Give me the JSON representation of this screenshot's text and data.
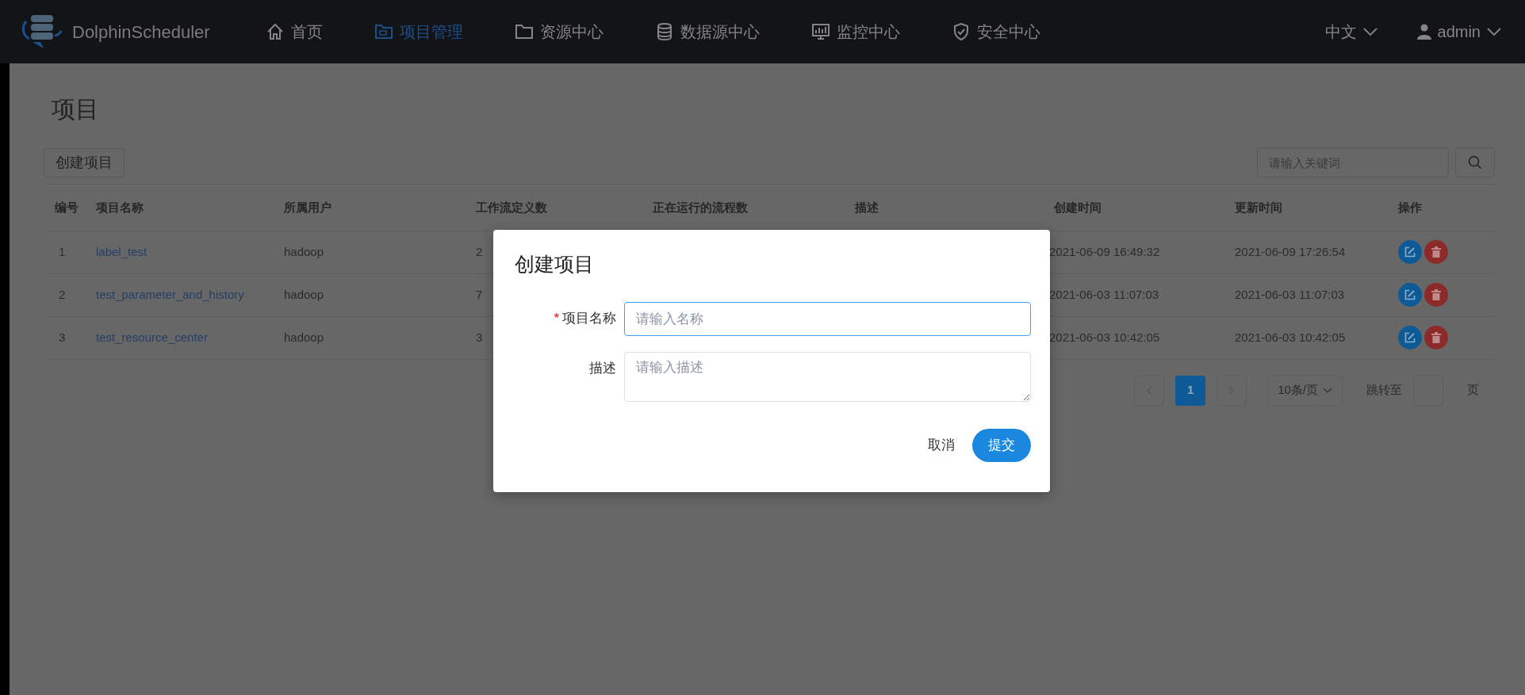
{
  "app": {
    "name": "DolphinScheduler"
  },
  "nav": [
    {
      "label": "首页",
      "kind": "home",
      "selected": false
    },
    {
      "label": "项目管理",
      "kind": "projects",
      "selected": true
    },
    {
      "label": "资源中心",
      "kind": "resources",
      "selected": false
    },
    {
      "label": "数据源中心",
      "kind": "datasource",
      "selected": false
    },
    {
      "label": "监控中心",
      "kind": "monitor",
      "selected": false
    },
    {
      "label": "安全中心",
      "kind": "security",
      "selected": false
    }
  ],
  "language": "中文",
  "user": "admin",
  "page": {
    "title": "项目"
  },
  "toolbar": {
    "create_button": "创建项目",
    "search": {
      "placeholder": "请输入关键词"
    }
  },
  "table": {
    "columns": [
      "编号",
      "项目名称",
      "所属用户",
      "工作流定义数",
      "正在运行的流程数",
      "描述",
      "创建时间",
      "更新时间",
      "操作"
    ],
    "rows": [
      {
        "id": "1",
        "name": "label_test",
        "owner": "hadoop",
        "workflow_count": "2",
        "created": "2021-06-09 16:49:32",
        "updated": "2021-06-09 17:26:54"
      },
      {
        "id": "2",
        "name": "test_parameter_and_history",
        "owner": "hadoop",
        "workflow_count": "7",
        "created": "2021-06-03 11:07:03",
        "updated": "2021-06-03 11:07:03"
      },
      {
        "id": "3",
        "name": "test_resource_center",
        "owner": "hadoop",
        "workflow_count": "3",
        "created": "2021-06-03 10:42:05",
        "updated": "2021-06-03 10:42:05"
      }
    ]
  },
  "pagination": {
    "pages": [
      {
        "label": "1",
        "selected": true
      }
    ],
    "page_size": "10条/页",
    "jump_label": "跳转至",
    "page_unit": "页"
  },
  "dialog": {
    "title": "创建项目",
    "required_mark": "*",
    "fields": [
      {
        "label": "项目名称",
        "required": true,
        "placeholder": "请输入名称",
        "kind": "input",
        "focused": true
      },
      {
        "label": "描述",
        "required": false,
        "placeholder": "请输入描述",
        "kind": "textarea",
        "focused": false
      }
    ],
    "buttons": [
      {
        "label": "取消",
        "kind": "text"
      },
      {
        "label": "提交",
        "kind": "primary"
      }
    ]
  }
}
